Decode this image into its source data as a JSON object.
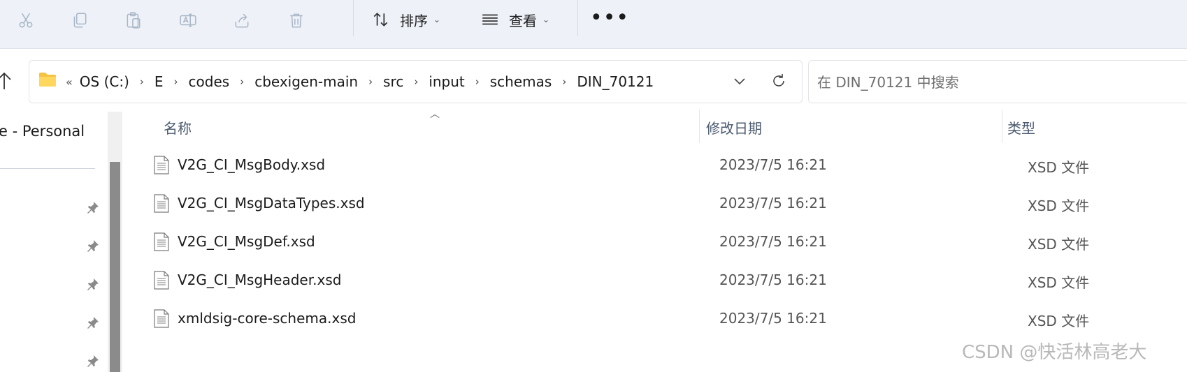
{
  "toolbar": {
    "actions": [
      {
        "icon": "cut-icon"
      },
      {
        "icon": "copy-icon"
      },
      {
        "icon": "paste-icon"
      },
      {
        "icon": "rename-icon"
      },
      {
        "icon": "share-icon"
      },
      {
        "icon": "delete-icon"
      }
    ],
    "sort_label": "排序",
    "view_label": "查看",
    "more_label": "•••"
  },
  "address": {
    "lead": "«",
    "crumbs": [
      "OS (C:)",
      "E",
      "codes",
      "cbexigen-main",
      "src",
      "input",
      "schemas",
      "DIN_70121"
    ]
  },
  "search": {
    "placeholder": "在 DIN_70121 中搜索"
  },
  "nav": {
    "personal_label": "e - Personal"
  },
  "list": {
    "columns": {
      "name": "名称",
      "date": "修改日期",
      "type": "类型"
    },
    "files": [
      {
        "name": "V2G_CI_MsgBody.xsd",
        "date": "2023/7/5 16:21",
        "type": "XSD 文件"
      },
      {
        "name": "V2G_CI_MsgDataTypes.xsd",
        "date": "2023/7/5 16:21",
        "type": "XSD 文件"
      },
      {
        "name": "V2G_CI_MsgDef.xsd",
        "date": "2023/7/5 16:21",
        "type": "XSD 文件"
      },
      {
        "name": "V2G_CI_MsgHeader.xsd",
        "date": "2023/7/5 16:21",
        "type": "XSD 文件"
      },
      {
        "name": "xmldsig-core-schema.xsd",
        "date": "2023/7/5 16:21",
        "type": "XSD 文件"
      }
    ]
  },
  "watermark": "CSDN @快活林高老大",
  "colors": {
    "toolbar_bg": "#eef2f8",
    "disabled_icon": "#a9b6c6",
    "folder": "#f5c342"
  }
}
